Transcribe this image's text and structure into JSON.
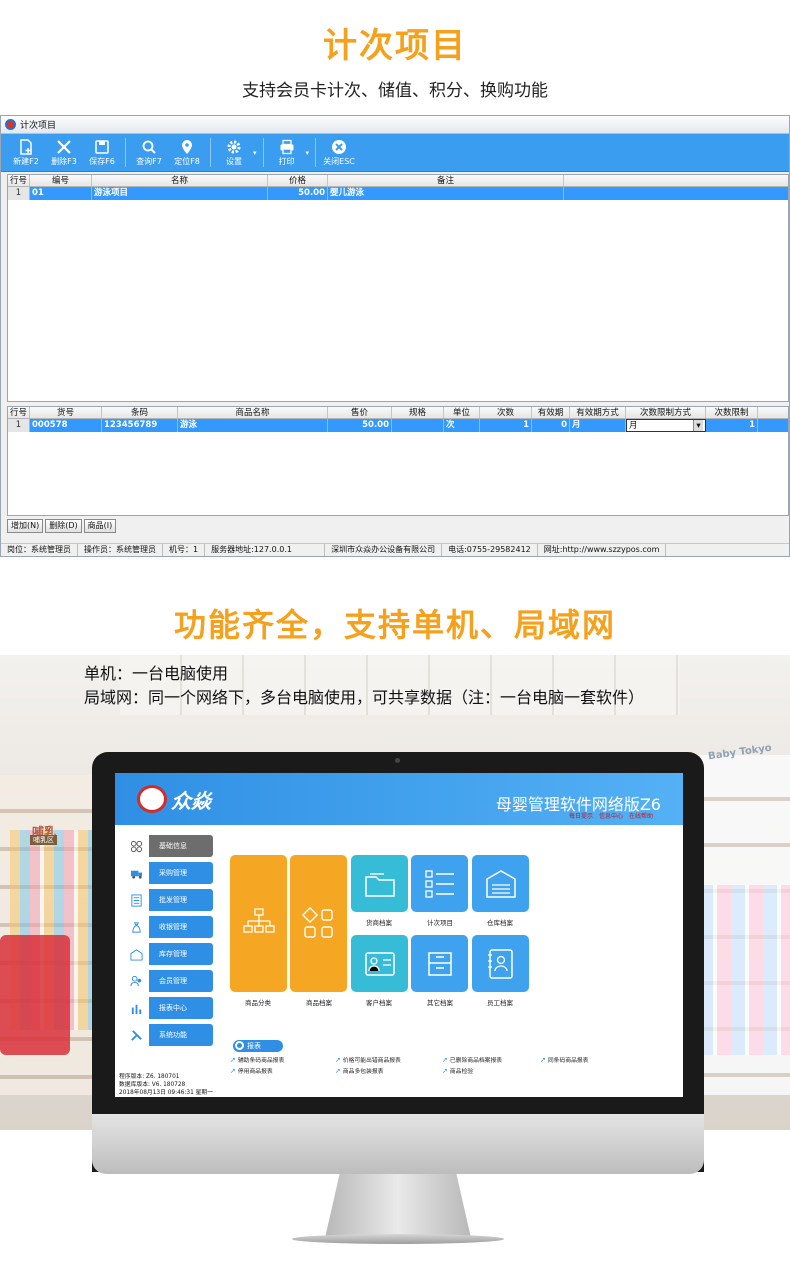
{
  "section1": {
    "title": "计次项目",
    "subtitle": "支持会员卡计次、储值、积分、换购功能"
  },
  "window": {
    "title": "计次项目",
    "toolbar": [
      {
        "label": "新建F2",
        "icon": "new-doc-icon"
      },
      {
        "label": "删除F3",
        "icon": "delete-x-icon"
      },
      {
        "label": "保存F6",
        "icon": "save-icon"
      },
      {
        "label": "查询F7",
        "icon": "search-icon"
      },
      {
        "label": "定位F8",
        "icon": "location-pin-icon"
      },
      {
        "label": "设置",
        "icon": "gear-icon"
      },
      {
        "label": "打印",
        "icon": "printer-icon"
      },
      {
        "label": "关闭ESC",
        "icon": "close-circle-icon"
      }
    ],
    "top_grid": {
      "headers": [
        "行号",
        "编号",
        "名称",
        "价格",
        "备注"
      ],
      "rows": [
        {
          "row": "1",
          "code": "01",
          "name": "游泳项目",
          "price": "50.00",
          "note": "婴儿游泳"
        }
      ]
    },
    "bottom_grid": {
      "headers": [
        "行号",
        "货号",
        "条码",
        "商品名称",
        "售价",
        "规格",
        "单位",
        "次数",
        "有效期",
        "有效期方式",
        "次数限制方式",
        "次数限制"
      ],
      "rows": [
        {
          "row": "1",
          "sku": "000578",
          "barcode": "123456789",
          "name": "游泳",
          "price": "50.00",
          "spec": "",
          "unit": "次",
          "count": "1",
          "valid": "0",
          "valid_mode": "月",
          "limit_mode": "月",
          "limit": "1"
        }
      ]
    },
    "buttons": [
      "增加(N)",
      "删除(D)",
      "商品(I)"
    ],
    "status": [
      "岗位：系统管理员",
      "操作员：系统管理员",
      "机号：1",
      "服务器地址:127.0.0.1",
      "深圳市众焱办公设备有限公司",
      "电话:0755-29582412",
      "网址:http://www.szzypos.com"
    ]
  },
  "section2": {
    "title": "功能齐全，支持单机、局域网",
    "line1": "单机：一台电脑使用",
    "line2": "局域网：同一个网络下，多台电脑使用，可共享数据（注：一台电脑一套软件）"
  },
  "background_signs": {
    "brand_right": "Baby Tokyo",
    "sign_left": "哺乳",
    "sign_left_small": "哺乳区"
  },
  "screen": {
    "logo_text": "众焱",
    "title": "母婴管理软件网络版Z6",
    "links": [
      "每日提示",
      "信息中心",
      "在线帮助"
    ],
    "sidebar": [
      {
        "label": "基础信息",
        "icon": "blocks-icon",
        "active": true
      },
      {
        "label": "采购管理",
        "icon": "truck-icon"
      },
      {
        "label": "批发管理",
        "icon": "list-icon"
      },
      {
        "label": "收银管理",
        "icon": "money-bag-icon"
      },
      {
        "label": "库存管理",
        "icon": "warehouse-icon"
      },
      {
        "label": "会员管理",
        "icon": "users-icon"
      },
      {
        "label": "报表中心",
        "icon": "bar-chart-icon"
      },
      {
        "label": "系统功能",
        "icon": "tools-icon"
      }
    ],
    "tiles": [
      {
        "label": "商品分类",
        "icon": "hierarchy-icon"
      },
      {
        "label": "商品档案",
        "icon": "squares-icon"
      },
      {
        "label": "货商档案",
        "icon": "folder-icon"
      },
      {
        "label": "计次项目",
        "icon": "checklist-icon"
      },
      {
        "label": "仓库档案",
        "icon": "warehouse-icon"
      },
      {
        "label": "客户档案",
        "icon": "contact-card-icon"
      },
      {
        "label": "其它档案",
        "icon": "drawer-icon"
      },
      {
        "label": "员工档案",
        "icon": "address-book-icon"
      }
    ],
    "reports_label": "报表",
    "reports": [
      "辅助条码商品报表",
      "价格可能出错商品报表",
      "已删除商品档案报表",
      "同条码商品报表",
      "停用商品报表",
      "商品多包装报表",
      "商品检验"
    ],
    "version": {
      "program": "程序版本: Z6. 180701",
      "database": "数据库版本: V6. 180728",
      "datetime": "2018年08月13日 09:46:31 星期一"
    }
  },
  "colors": {
    "accent_orange": "#f5a11d",
    "toolbar_blue": "#3b9df0",
    "row_highlight": "#3399ff",
    "tile_orange": "#f5a623",
    "tile_teal": "#37bcd8",
    "tile_blue": "#3fa2ef"
  }
}
